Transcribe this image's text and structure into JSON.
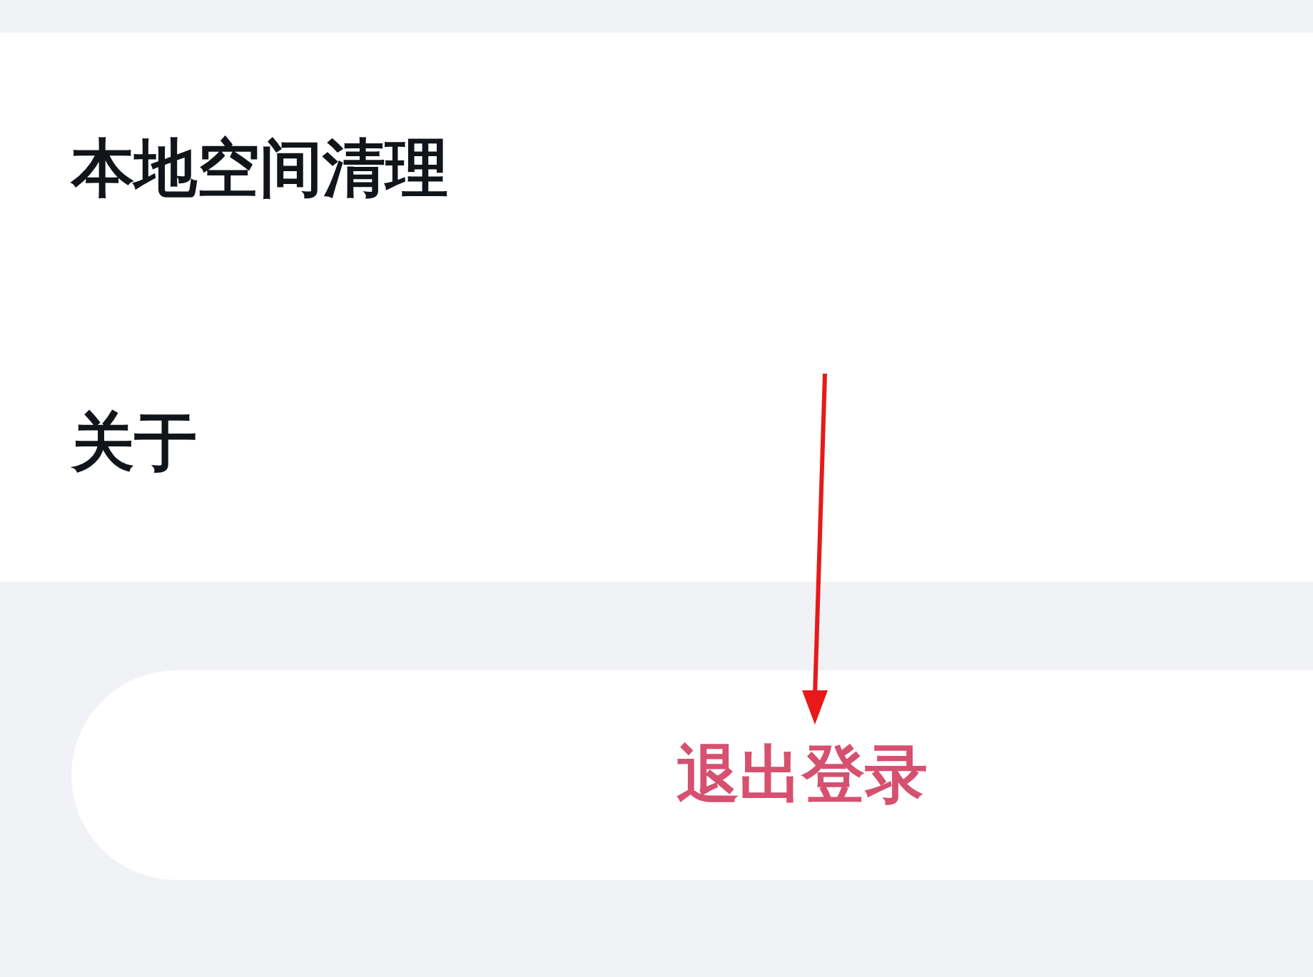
{
  "settings_items": [
    {
      "label": "本地空间清理"
    },
    {
      "label": "关于"
    }
  ],
  "logout_button": {
    "label": "退出登录"
  }
}
